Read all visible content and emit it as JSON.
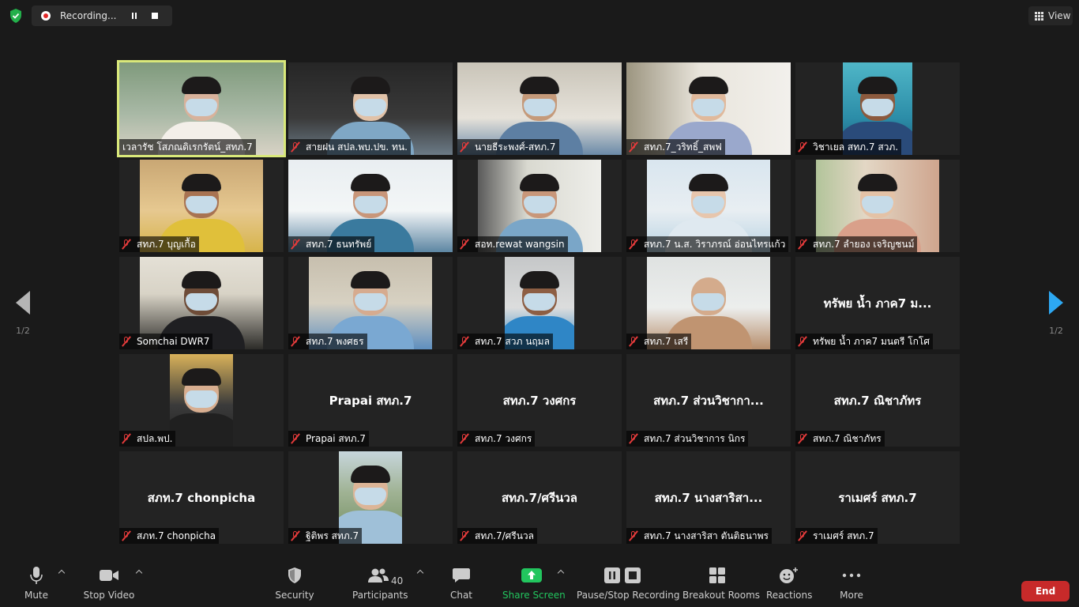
{
  "recording": {
    "label": "Recording...",
    "pause": "pause",
    "stop": "stop"
  },
  "view": {
    "label": "View"
  },
  "nav": {
    "left_page": "1/2",
    "right_page": "1/2"
  },
  "tiles": [
    {
      "name": "เวลารัช โสภณดิเรกรัตน์_สทภ.7",
      "video": true,
      "active": true,
      "muted": false
    },
    {
      "name": "สายฝน สปล.พบ.ปข. ทน.",
      "video": true,
      "muted": true
    },
    {
      "name": "นายธีระพงศ์-สทภ.7",
      "video": true,
      "muted": true
    },
    {
      "name": "สทภ.7_วริทธิ์_สพฟ",
      "video": true,
      "muted": true
    },
    {
      "name": "วิชาเยล สทภ.7 สวภ.",
      "video": true,
      "muted": true
    },
    {
      "name": "สทภ.7 บุญเกื้อ",
      "video": true,
      "muted": true
    },
    {
      "name": "สทภ.7 ธนทรัพย์",
      "video": true,
      "muted": true
    },
    {
      "name": "สอท.rewat wangsin",
      "video": true,
      "muted": true
    },
    {
      "name": "สทภ.7 น.ส. วิราภรณ์ อ่อนไทรแก้ว",
      "video": true,
      "muted": true
    },
    {
      "name": "สทภ.7 ลำยอง เจริญชนม์",
      "video": true,
      "muted": true
    },
    {
      "name": "Somchai DWR7",
      "video": true,
      "muted": true
    },
    {
      "name": "สทภ.7 พงศธร",
      "video": true,
      "muted": true
    },
    {
      "name": "สทภ.7 สวภ นฤมล",
      "video": true,
      "muted": true
    },
    {
      "name": "สทภ.7 เสรี",
      "video": true,
      "muted": true
    },
    {
      "name": "ทรัพย น้ำ ภาค7 มนตรี โกโศ",
      "display": "ทรัพย น้ำ ภาค7 ม...",
      "video": false,
      "muted": true
    },
    {
      "name": "สปล.พป.",
      "video": true,
      "muted": true
    },
    {
      "name": "Prapai สทภ.7",
      "display": "Prapai สทภ.7",
      "video": false,
      "muted": true
    },
    {
      "name": "สทภ.7 วงศกร",
      "display": "สทภ.7 วงศกร",
      "video": false,
      "muted": true
    },
    {
      "name": "สทภ.7 ส่วนวิชาการ นิกร",
      "display": "สทภ.7 ส่วนวิชากา...",
      "video": false,
      "muted": true
    },
    {
      "name": "สทภ.7 ณิชาภัทร",
      "display": "สทภ.7 ณิชาภัทร",
      "video": false,
      "muted": true
    },
    {
      "name": "สภท.7 chonpicha",
      "display": "สภท.7 chonpicha",
      "video": false,
      "muted": true
    },
    {
      "name": "ฐิติพร   สทภ.7",
      "video": true,
      "muted": true
    },
    {
      "name": "สทภ.7/ศรีนวล",
      "display": "สทภ.7/ศรีนวล",
      "video": false,
      "muted": true
    },
    {
      "name": "สทภ.7 นางสาริสา ตันติธนาพร",
      "display": "สทภ.7 นางสาริสา...",
      "video": false,
      "muted": true
    },
    {
      "name": "ราเมศร์ สทภ.7",
      "display": "ราเมศร์ สทภ.7",
      "video": false,
      "muted": true
    }
  ],
  "toolbar": {
    "mute": "Mute",
    "stop_video": "Stop Video",
    "security": "Security",
    "participants": "Participants",
    "participants_count": "40",
    "chat": "Chat",
    "share_screen": "Share Screen",
    "pause_stop_recording": "Pause/Stop Recording",
    "breakout_rooms": "Breakout Rooms",
    "reactions": "Reactions",
    "more": "More",
    "end": "End"
  },
  "colors": {
    "background": "#1a1a1a",
    "tile": "#232323",
    "active_border": "#d9e87a",
    "muted_icon": "#e43b3b",
    "share_green": "#22c55e",
    "end_red": "#c72a2a",
    "nav_arrow_right": "#2da8f2"
  }
}
